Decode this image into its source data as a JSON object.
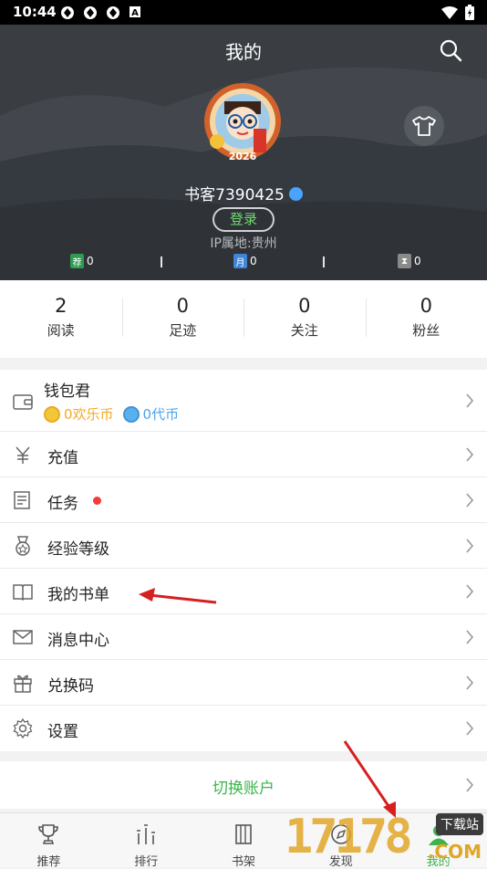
{
  "status_bar": {
    "time": "10:44"
  },
  "header": {
    "title": "我的",
    "username": "书客7390425",
    "login_label": "登录",
    "ip_location": "IP属地:贵州",
    "avatar_year": "2026",
    "tickets": [
      {
        "icon": "荐",
        "value": "0",
        "color": "#2e9d52"
      },
      {
        "icon": "月",
        "value": "0",
        "color": "#3f86d8"
      },
      {
        "icon": "⧗",
        "value": "0",
        "color": "#8a8a8a"
      }
    ]
  },
  "stats": [
    {
      "value": "2",
      "label": "阅读"
    },
    {
      "value": "0",
      "label": "足迹"
    },
    {
      "value": "0",
      "label": "关注"
    },
    {
      "value": "0",
      "label": "粉丝"
    }
  ],
  "wallet": {
    "label": "钱包君",
    "joy_coins": "0欢乐币",
    "dai_coins": "0代币"
  },
  "menu": [
    {
      "label": "充值",
      "icon": "yuan-icon"
    },
    {
      "label": "任务",
      "icon": "task-icon"
    },
    {
      "label": "经验等级",
      "icon": "medal-icon"
    },
    {
      "label": "我的书单",
      "icon": "booklist-icon"
    },
    {
      "label": "消息中心",
      "icon": "mail-icon"
    },
    {
      "label": "兑换码",
      "icon": "gift-icon"
    },
    {
      "label": "设置",
      "icon": "gear-icon"
    }
  ],
  "switch_account": "切换账户",
  "tabs": [
    {
      "label": "推荐",
      "icon": "trophy-icon"
    },
    {
      "label": "排行",
      "icon": "ranking-icon"
    },
    {
      "label": "书架",
      "icon": "bookshelf-icon"
    },
    {
      "label": "发现",
      "icon": "discover-icon"
    },
    {
      "label": "我的",
      "icon": "profile-icon"
    }
  ],
  "watermark": {
    "number": "17178",
    "text": "下载站",
    "domain": ".COM"
  },
  "colors": {
    "accent_green": "#3bb54a",
    "header_bg": "#3b3f44",
    "red_dot": "#f23b3b"
  }
}
